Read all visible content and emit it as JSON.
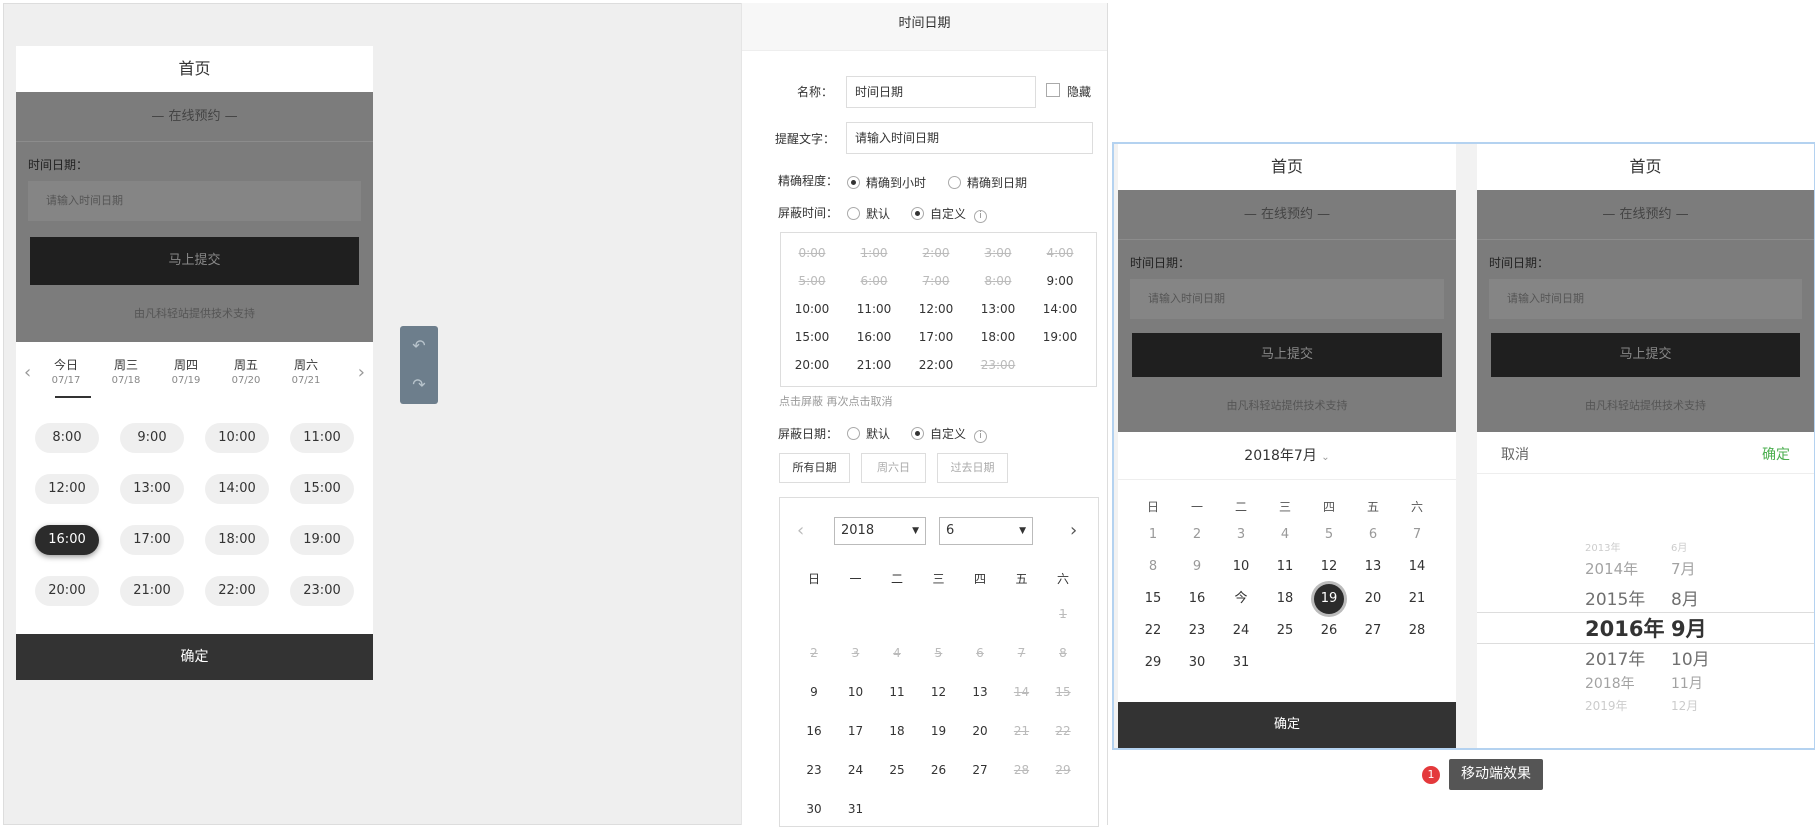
{
  "preview": {
    "title": "首页",
    "section": "在线预约",
    "field_label": "时间日期：",
    "placeholder": "请输入时间日期",
    "submit": "马上提交",
    "powered": "由凡科轻站提供技术支持",
    "confirm": "确定",
    "days": [
      {
        "w": "今日",
        "d": "07/17"
      },
      {
        "w": "周三",
        "d": "07/18"
      },
      {
        "w": "周四",
        "d": "07/19"
      },
      {
        "w": "周五",
        "d": "07/20"
      },
      {
        "w": "周六",
        "d": "07/21"
      }
    ],
    "slots": [
      "8:00",
      "9:00",
      "10:00",
      "11:00",
      "12:00",
      "13:00",
      "14:00",
      "15:00",
      "16:00",
      "17:00",
      "18:00",
      "19:00",
      "20:00",
      "21:00",
      "22:00",
      "23:00"
    ],
    "selected_slot": "16:00"
  },
  "undo": {
    "undo_icon": "↶",
    "redo_icon": "↷"
  },
  "props": {
    "header": "时间日期",
    "name_label": "名称：",
    "name_value": "时间日期",
    "hide_label": "隐藏",
    "hint_label": "提醒文字：",
    "hint_value": "请输入时间日期",
    "precision_label": "精确程度：",
    "precision_hour": "精确到小时",
    "precision_day": "精确到日期",
    "block_time_label": "屏蔽时间：",
    "default": "默认",
    "custom": "自定义",
    "times": [
      {
        "t": "0:00",
        "dis": true
      },
      {
        "t": "1:00",
        "dis": true
      },
      {
        "t": "2:00",
        "dis": true
      },
      {
        "t": "3:00",
        "dis": true
      },
      {
        "t": "4:00",
        "dis": true
      },
      {
        "t": "5:00",
        "dis": true
      },
      {
        "t": "6:00",
        "dis": true
      },
      {
        "t": "7:00",
        "dis": true
      },
      {
        "t": "8:00",
        "dis": true
      },
      {
        "t": "9:00",
        "dis": false
      },
      {
        "t": "10:00",
        "dis": false
      },
      {
        "t": "11:00",
        "dis": false
      },
      {
        "t": "12:00",
        "dis": false
      },
      {
        "t": "13:00",
        "dis": false
      },
      {
        "t": "14:00",
        "dis": false
      },
      {
        "t": "15:00",
        "dis": false
      },
      {
        "t": "16:00",
        "dis": false
      },
      {
        "t": "17:00",
        "dis": false
      },
      {
        "t": "18:00",
        "dis": false
      },
      {
        "t": "19:00",
        "dis": false
      },
      {
        "t": "20:00",
        "dis": false
      },
      {
        "t": "21:00",
        "dis": false
      },
      {
        "t": "22:00",
        "dis": false
      },
      {
        "t": "23:00",
        "dis": true
      }
    ],
    "block_hint": "点击屏蔽 再次点击取消",
    "block_date_label": "屏蔽日期：",
    "date_btns": [
      "所有日期",
      "周六日",
      "过去日期"
    ],
    "cal_year": "2018",
    "cal_month": "6",
    "weekdays": [
      "日",
      "一",
      "二",
      "三",
      "四",
      "五",
      "六"
    ],
    "cal_rows": [
      [
        null,
        null,
        null,
        null,
        null,
        null,
        {
          "d": "1",
          "dis": true
        }
      ],
      [
        {
          "d": "2",
          "dis": true
        },
        {
          "d": "3",
          "dis": true
        },
        {
          "d": "4",
          "dis": true
        },
        {
          "d": "5",
          "dis": true
        },
        {
          "d": "6",
          "dis": true
        },
        {
          "d": "7",
          "dis": true
        },
        {
          "d": "8",
          "dis": true
        }
      ],
      [
        {
          "d": "9"
        },
        {
          "d": "10"
        },
        {
          "d": "11"
        },
        {
          "d": "12"
        },
        {
          "d": "13"
        },
        {
          "d": "14",
          "dis": true
        },
        {
          "d": "15",
          "dis": true
        }
      ],
      [
        {
          "d": "16"
        },
        {
          "d": "17"
        },
        {
          "d": "18"
        },
        {
          "d": "19"
        },
        {
          "d": "20"
        },
        {
          "d": "21",
          "dis": true
        },
        {
          "d": "22",
          "dis": true
        }
      ],
      [
        {
          "d": "23"
        },
        {
          "d": "24"
        },
        {
          "d": "25"
        },
        {
          "d": "26"
        },
        {
          "d": "27"
        },
        {
          "d": "28",
          "dis": true
        },
        {
          "d": "29",
          "dis": true
        }
      ],
      [
        {
          "d": "30"
        },
        {
          "d": "31"
        }
      ]
    ]
  },
  "mobile": {
    "month_title": "2018年7月",
    "weekdays": [
      "日",
      "一",
      "二",
      "三",
      "四",
      "五",
      "六"
    ],
    "rows": [
      [
        "1",
        "2",
        "3",
        "4",
        "5",
        "6",
        "7"
      ],
      [
        "8",
        "9",
        "10",
        "11",
        "12",
        "13",
        "14"
      ],
      [
        "15",
        "16",
        "今",
        "18",
        "19",
        "20",
        "21"
      ],
      [
        "22",
        "23",
        "24",
        "25",
        "26",
        "27",
        "28"
      ],
      [
        "29",
        "30",
        "31"
      ]
    ],
    "gray_days": [
      "1",
      "2",
      "3",
      "4",
      "5",
      "6",
      "7",
      "8",
      "9"
    ],
    "selected_day": "19",
    "cancel": "取消",
    "ok": "确定",
    "years": [
      "2013年",
      "2014年",
      "2015年",
      "2016年",
      "2017年",
      "2018年",
      "2019年"
    ],
    "months": [
      "6月",
      "7月",
      "8月",
      "9月",
      "10月",
      "11月",
      "12月"
    ],
    "tip": "移动端效果",
    "badge": "1"
  },
  "colors": {
    "accent_green": "#4caf50",
    "dark": "#333333"
  }
}
